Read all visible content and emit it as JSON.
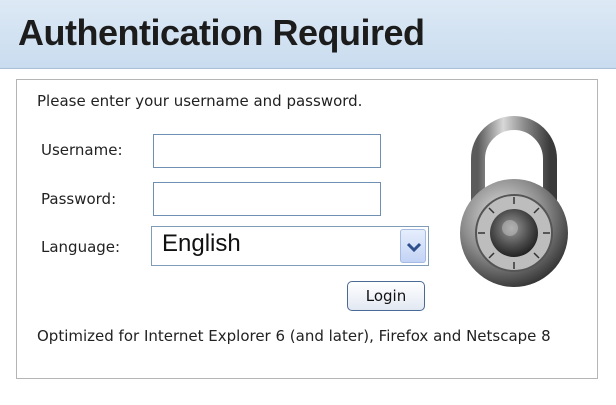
{
  "header": {
    "title": "Authentication Required"
  },
  "form": {
    "intro": "Please enter your username and password.",
    "username_label": "Username:",
    "username_value": "",
    "password_label": "Password:",
    "password_value": "",
    "language_label": "Language:",
    "language_selected": "English",
    "login_label": "Login"
  },
  "footer": {
    "note": "Optimized for Internet Explorer 6 (and later), Firefox and Netscape 8"
  },
  "icons": {
    "lock": "combination-padlock-icon",
    "dropdown": "chevron-down-icon"
  },
  "colors": {
    "header_bg": "#c9dcef",
    "field_border": "#6f8fb3",
    "accent": "#4a6a96"
  }
}
